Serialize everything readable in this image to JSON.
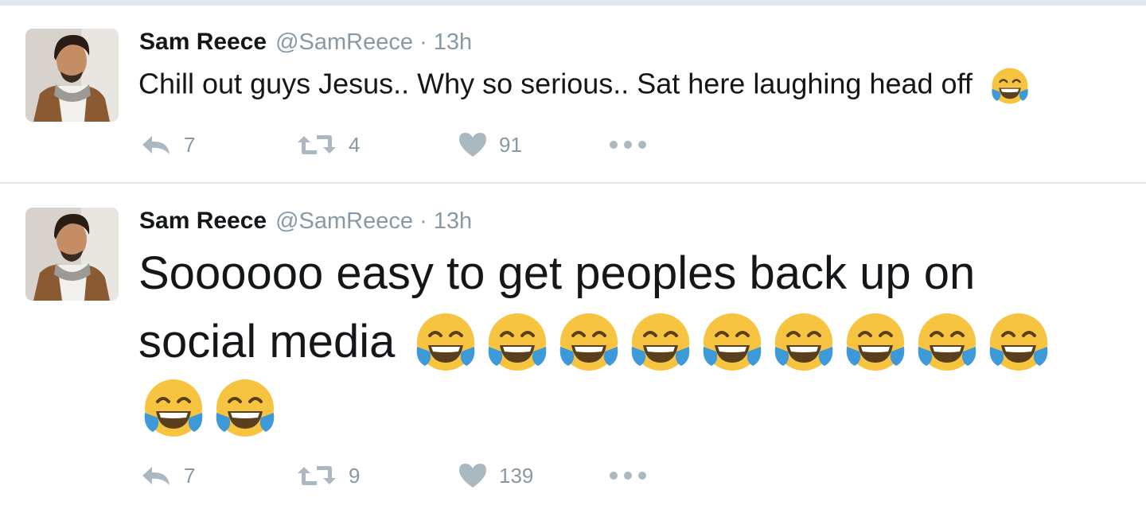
{
  "colors": {
    "text": "#14171a",
    "muted": "#8899a6",
    "divider": "#e1e8ed",
    "icon": "#aab8c2",
    "emoji_face": "#f7c441",
    "emoji_tears": "#3d99d8"
  },
  "tweets": [
    {
      "name": "Sam Reece",
      "handle": "@SamReece",
      "separator": "·",
      "time": "13h",
      "text": "Chill out guys Jesus.. Why so serious.. Sat here laughing head off",
      "emoji": "face-with-tears-of-joy",
      "emoji_count": 1,
      "actions": {
        "reply_count": "7",
        "retweet_count": "4",
        "like_count": "91"
      }
    },
    {
      "name": "Sam Reece",
      "handle": "@SamReece",
      "separator": "·",
      "time": "13h",
      "text_line1": "Soooooo easy to get peoples back up on",
      "text_line2": "social media",
      "emoji": "face-with-tears-of-joy",
      "emoji_count": 11,
      "actions": {
        "reply_count": "7",
        "retweet_count": "9",
        "like_count": "139"
      }
    }
  ],
  "icons": {
    "reply": "reply-icon",
    "retweet": "retweet-icon",
    "like": "heart-icon",
    "more": "more-icon"
  }
}
